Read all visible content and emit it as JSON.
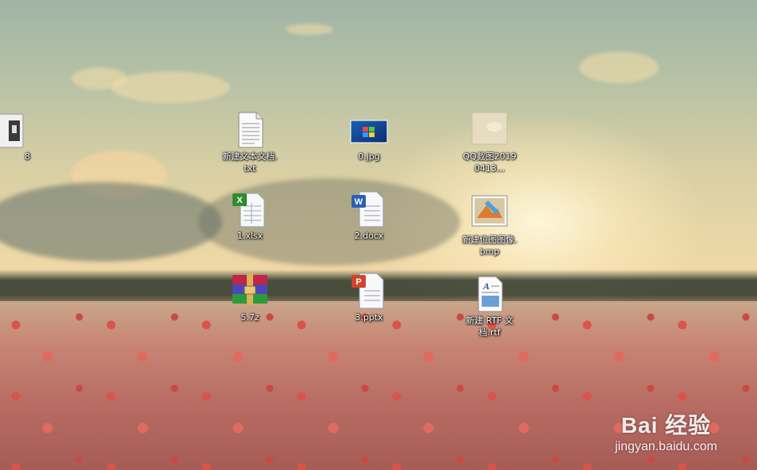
{
  "icons": [
    {
      "label": "8"
    },
    {
      "label": "新建文本文档.txt"
    },
    {
      "label": "0.jpg"
    },
    {
      "label": "QQ截图20190413..."
    },
    {
      "label": "1.xlsx"
    },
    {
      "label": "2.docx"
    },
    {
      "label": "新建位图图像.bmp"
    },
    {
      "label": "5.7z"
    },
    {
      "label": "3.pptx"
    },
    {
      "label": "新建 RTF 文档.rtf"
    }
  ],
  "watermark": {
    "brand": "Bai 经验",
    "url": "jingyan.baidu.com"
  }
}
